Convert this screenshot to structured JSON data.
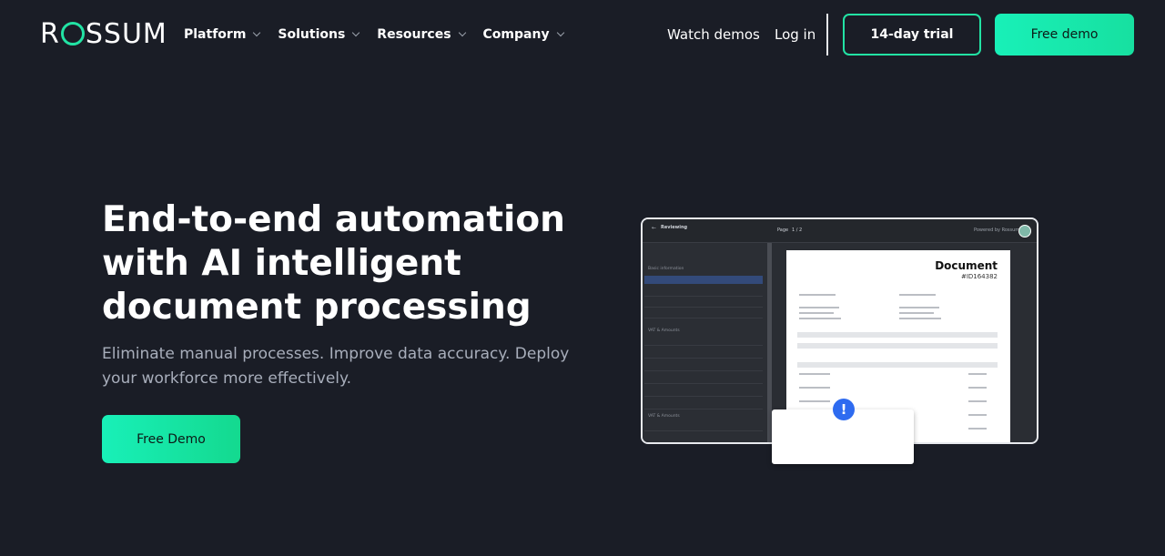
{
  "brand": {
    "logo_pre": "R",
    "logo_post": "SSUM",
    "accent": "#22e3a4"
  },
  "nav": {
    "menu": [
      {
        "label": "Platform"
      },
      {
        "label": "Solutions"
      },
      {
        "label": "Resources"
      },
      {
        "label": "Company"
      }
    ],
    "watch_demos": "Watch demos",
    "login": "Log in",
    "trial_button": "14-day trial",
    "demo_button": "Free demo"
  },
  "hero": {
    "title": "End-to-end automation with AI intelligent document processing",
    "subtitle": "Eliminate manual processes. Improve data accuracy. Deploy your workforce more effectively.",
    "cta": "Free Demo"
  },
  "mockup": {
    "status": "Reviewing",
    "page_label": "Page",
    "page_value": "1 / 2",
    "powered": "Powered by Rossum",
    "section_basic": "Basic information",
    "section_vat": "VAT & Amounts",
    "section_vat2": "VAT & Amounts",
    "document_title": "Document",
    "document_id": "#ID164382",
    "alert_symbol": "!"
  }
}
